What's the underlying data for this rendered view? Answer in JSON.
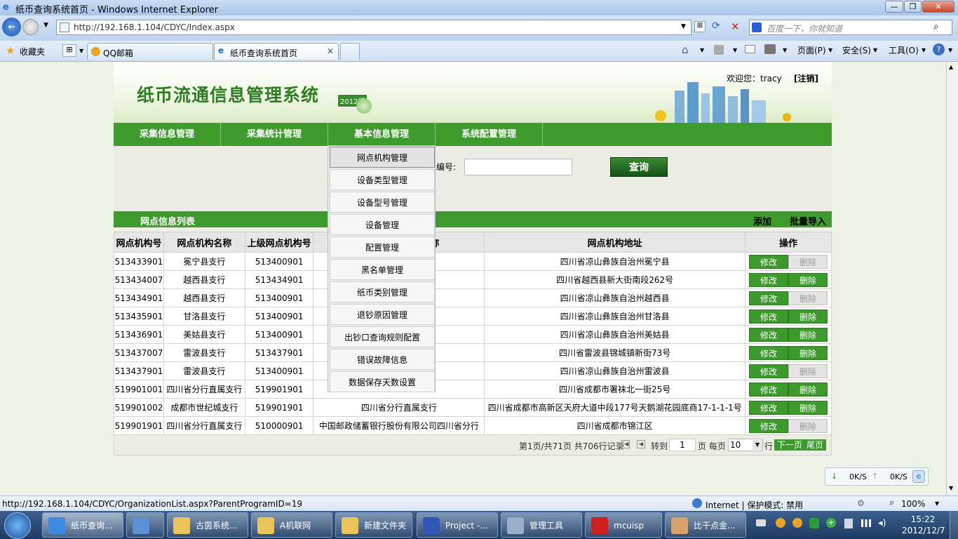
{
  "window": {
    "title": "纸币查询系统首页 - Windows Internet Explorer",
    "min": "—",
    "max": "❐",
    "close": "✕"
  },
  "browser": {
    "address": "http://192.168.1.104/CDYC/Index.aspx",
    "search_placeholder": "百度一下，你就知道",
    "favorites": "收藏夹",
    "tabs": [
      {
        "label": "QQ邮箱"
      },
      {
        "label": "纸币查询系统首页"
      }
    ],
    "commands": {
      "page": "页面(P)",
      "safety": "安全(S)",
      "tools": "工具(O)"
    }
  },
  "site": {
    "logo": "纸币流通信息管理系统",
    "badge": "2012版",
    "welcome": "欢迎您：tracy",
    "logout": "[注销]"
  },
  "menu": [
    {
      "label": "采集信息管理"
    },
    {
      "label": "采集统计管理"
    },
    {
      "label": "基本信息管理"
    },
    {
      "label": "系统配置管理"
    }
  ],
  "search": {
    "code_label": "编号:",
    "code_value": "",
    "query_label": "查询"
  },
  "list": {
    "title": "网点信息列表",
    "add": "添加",
    "import": "批量导入",
    "headers": [
      "网点机构号",
      "网点机构名称",
      "上级网点机构号",
      "称",
      "网点机构地址",
      "操作"
    ],
    "edit_label": "修改",
    "delete_label": "删除",
    "rows": [
      {
        "code": "513433901",
        "name": "冕宁县支行",
        "parent": "513400901",
        "pname": "",
        "addr": "四川省凉山彝族自治州冕宁县",
        "del_enabled": false
      },
      {
        "code": "513434007",
        "name": "越西县支行",
        "parent": "513434901",
        "pname": "",
        "addr": "四川省越西县新大街南段262号",
        "del_enabled": true
      },
      {
        "code": "513434901",
        "name": "越西县支行",
        "parent": "513400901",
        "pname": "",
        "addr": "四川省凉山彝族自治州越西县",
        "del_enabled": false
      },
      {
        "code": "513435901",
        "name": "甘洛县支行",
        "parent": "513400901",
        "pname": "",
        "addr": "四川省凉山彝族自治州甘洛县",
        "del_enabled": true
      },
      {
        "code": "513436901",
        "name": "美姑县支行",
        "parent": "513400901",
        "pname": "",
        "addr": "四川省凉山彝族自治州美姑县",
        "del_enabled": true
      },
      {
        "code": "513437007",
        "name": "雷波县支行",
        "parent": "513437901",
        "pname": "",
        "addr": "四川省雷波县锦城镇新街73号",
        "del_enabled": true
      },
      {
        "code": "513437901",
        "name": "雷波县支行",
        "parent": "513400901",
        "pname": "",
        "addr": "四川省凉山彝族自治州雷波县",
        "del_enabled": false
      },
      {
        "code": "519901001",
        "name": "四川省分行直属支行",
        "parent": "519901901",
        "pname": "",
        "addr": "四川省成都市署袜北一街25号",
        "del_enabled": true
      },
      {
        "code": "519901002",
        "name": "成都市世纪城支行",
        "parent": "519901901",
        "pname": "四川省分行直属支行",
        "addr": "四川省成都市高新区天府大道中段177号天鹅湖花园底商17-1-1-1号",
        "del_enabled": true
      },
      {
        "code": "519901901",
        "name": "四川省分行直属支行",
        "parent": "510000901",
        "pname": "中国邮政储蓄银行股份有限公司四川省分行",
        "addr": "四川省成都市锦江区",
        "del_enabled": false
      }
    ]
  },
  "pager": {
    "info": "第1页/共71页 共706行记录",
    "goto": "转到",
    "page_value": "1",
    "page_unit": "页 每页",
    "size_value": "10",
    "rows_unit": "行",
    "next": "下一页",
    "last": "尾页"
  },
  "dropdown": [
    "网点机构管理",
    "设备类型管理",
    "设备型号管理",
    "设备管理",
    "配置管理",
    "黑名单管理",
    "纸币类别管理",
    "退钞原因管理",
    "出钞口查询规则配置",
    "错误故障信息",
    "数据保存天数设置"
  ],
  "netmon": {
    "down": "0K/S",
    "up": "0K/S"
  },
  "status": {
    "url": "http://192.168.1.104/CDYC/OrganizationList.aspx?ParentProgramID=19",
    "zone": "Internet | 保护模式: 禁用",
    "zoom": "100%"
  },
  "taskbar": {
    "items": [
      {
        "label": "纸币查询..."
      },
      {
        "label": ""
      },
      {
        "label": "古茵系统..."
      },
      {
        "label": "A机联网"
      },
      {
        "label": "新建文件夹"
      },
      {
        "label": "Project  -..."
      },
      {
        "label": "管理工具"
      },
      {
        "label": "mcuisp"
      },
      {
        "label": "比干点金..."
      }
    ],
    "time": "15:22",
    "date": "2012/12/7"
  }
}
